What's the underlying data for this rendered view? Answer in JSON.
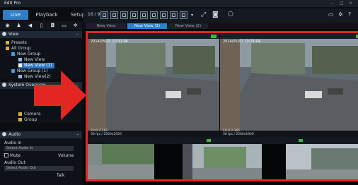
{
  "window": {
    "title": "Edit Pro"
  },
  "tabs": [
    {
      "label": "Live"
    },
    {
      "label": "Playback"
    },
    {
      "label": "Setup"
    }
  ],
  "left_toolbar_icons": [
    "eye-icon",
    "person-icon",
    "speaker-icon",
    "document-icon",
    "camera-icon",
    "monitor-icon",
    "gear-icon"
  ],
  "view_panel": {
    "title": "View",
    "tree": [
      {
        "label": "Presets"
      },
      {
        "label": "All Group"
      },
      {
        "label": "New Group"
      },
      {
        "label": "New View"
      },
      {
        "label": "New View (1)"
      },
      {
        "label": "New Group (1)"
      },
      {
        "label": "New View(2)"
      }
    ]
  },
  "system_panel": {
    "title": "System Overview",
    "tree": [
      {
        "label": "Camera"
      },
      {
        "label": "Group"
      }
    ]
  },
  "audio_panel": {
    "title": "Audio",
    "audio_in_label": "Audio In",
    "audio_in_select": "Select Audio In",
    "mute_label": "Mute",
    "volume_label": "Volume",
    "audio_out_label": "Audio Out",
    "audio_out_select": "Select Audio Out",
    "talk_label": "Talk"
  },
  "toolbar": {
    "layout_label": "16 / 9",
    "layout_count": 9
  },
  "view_tabs": [
    {
      "label": "New View"
    },
    {
      "label": "New View (1)"
    },
    {
      "label": "New View (2)"
    }
  ],
  "tiles": [
    {
      "overlay": "2014/05/01 10:31:04",
      "info1": "10.0.2.161",
      "info2": "30 fps / 2560x1920"
    },
    {
      "overlay": "2014/05/01 10:31:04",
      "info1": "10.0.2.161",
      "info2": "30 fps / 2560x1920"
    },
    {
      "overlay": "",
      "info1": "",
      "info2": ""
    },
    {
      "overlay": "",
      "info1": "",
      "info2": ""
    },
    {
      "overlay": "",
      "info1": "",
      "info2": ""
    }
  ],
  "colors": {
    "accent": "#2f7fc6",
    "highlight": "#e32622",
    "status_ok": "#2fbf3a"
  }
}
